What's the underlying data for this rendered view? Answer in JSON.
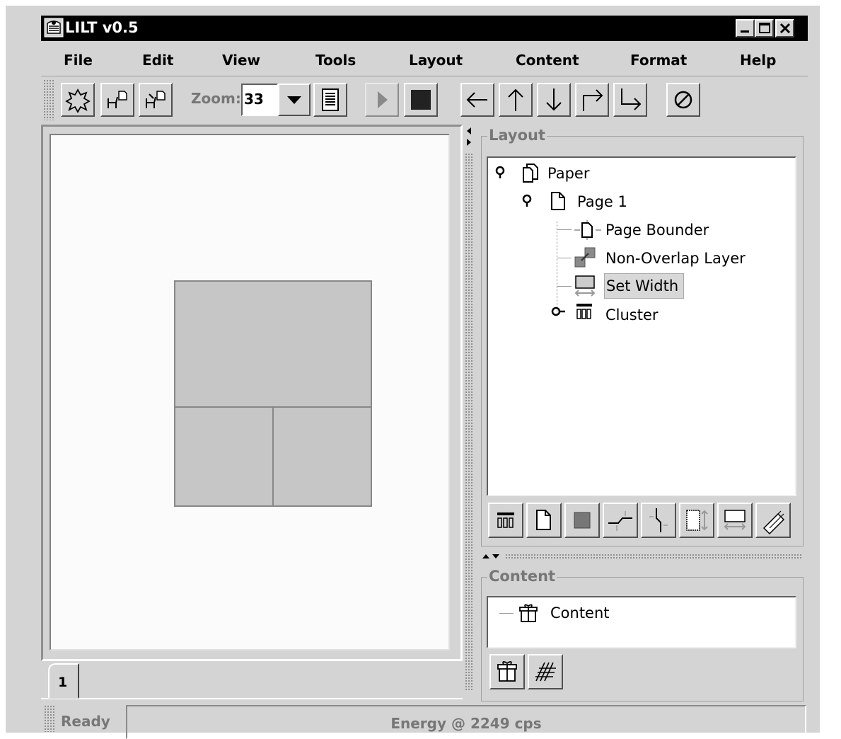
{
  "window": {
    "title": "LILT v0.5"
  },
  "menu": [
    "File",
    "Edit",
    "View",
    "Tools",
    "Layout",
    "Content",
    "Format",
    "Help"
  ],
  "toolbar": {
    "zoom_label": "Zoom:",
    "zoom_value": "33"
  },
  "canvas": {
    "page_tab": "1"
  },
  "layout_panel": {
    "title": "Layout",
    "tree": [
      {
        "label": "Paper",
        "icon": "pages-icon"
      },
      {
        "label": "Page 1",
        "icon": "page-icon"
      },
      {
        "label": "Page Bounder",
        "icon": "page-bounder-icon"
      },
      {
        "label": "Non-Overlap Layer",
        "icon": "non-overlap-icon"
      },
      {
        "label": "Set Width",
        "icon": "set-width-icon",
        "selected": true
      },
      {
        "label": "Cluster",
        "icon": "cluster-icon"
      }
    ]
  },
  "content_panel": {
    "title": "Content",
    "items": [
      {
        "label": "Content",
        "icon": "gift-icon"
      }
    ]
  },
  "status": {
    "left": "Ready",
    "right": "Energy @ 2249 cps"
  }
}
